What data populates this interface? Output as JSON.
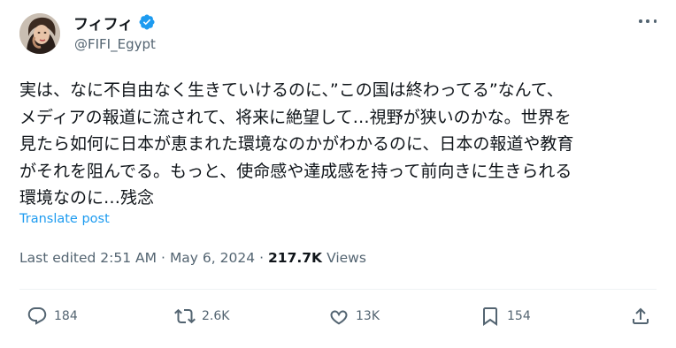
{
  "user": {
    "display_name": "フィフィ",
    "handle": "@FIFI_Egypt"
  },
  "tweet": {
    "lines": [
      "実は、なに不自由なく生きていけるのに、”この国は終わってる”なんて、",
      "メディアの報道に流されて、将来に絶望して…視野が狭いのかな。世界を",
      "見たら如何に日本が恵まれた環境なのかがわかるのに、日本の報道や教育",
      "がそれを阻んでる。もっと、使命感や達成感を持って前向きに生きられる",
      "環境なのに…残念"
    ],
    "translate_label": "Translate post"
  },
  "meta": {
    "edited": "Last edited 2:51 AM",
    "separator": "·",
    "date": "May 6, 2024",
    "views_count": "217.7K",
    "views_label": "Views"
  },
  "actions": {
    "reply_count": "184",
    "repost_count": "2.6K",
    "like_count": "13K",
    "bookmark_count": "154"
  },
  "colors": {
    "accent": "#1d9bf0",
    "secondary_text": "#536471",
    "primary_text": "#0f1419",
    "divider": "#eff3f4"
  },
  "icons": [
    "verified-badge-icon",
    "more-icon",
    "reply-icon",
    "repost-icon",
    "like-icon",
    "bookmark-icon",
    "share-icon"
  ]
}
